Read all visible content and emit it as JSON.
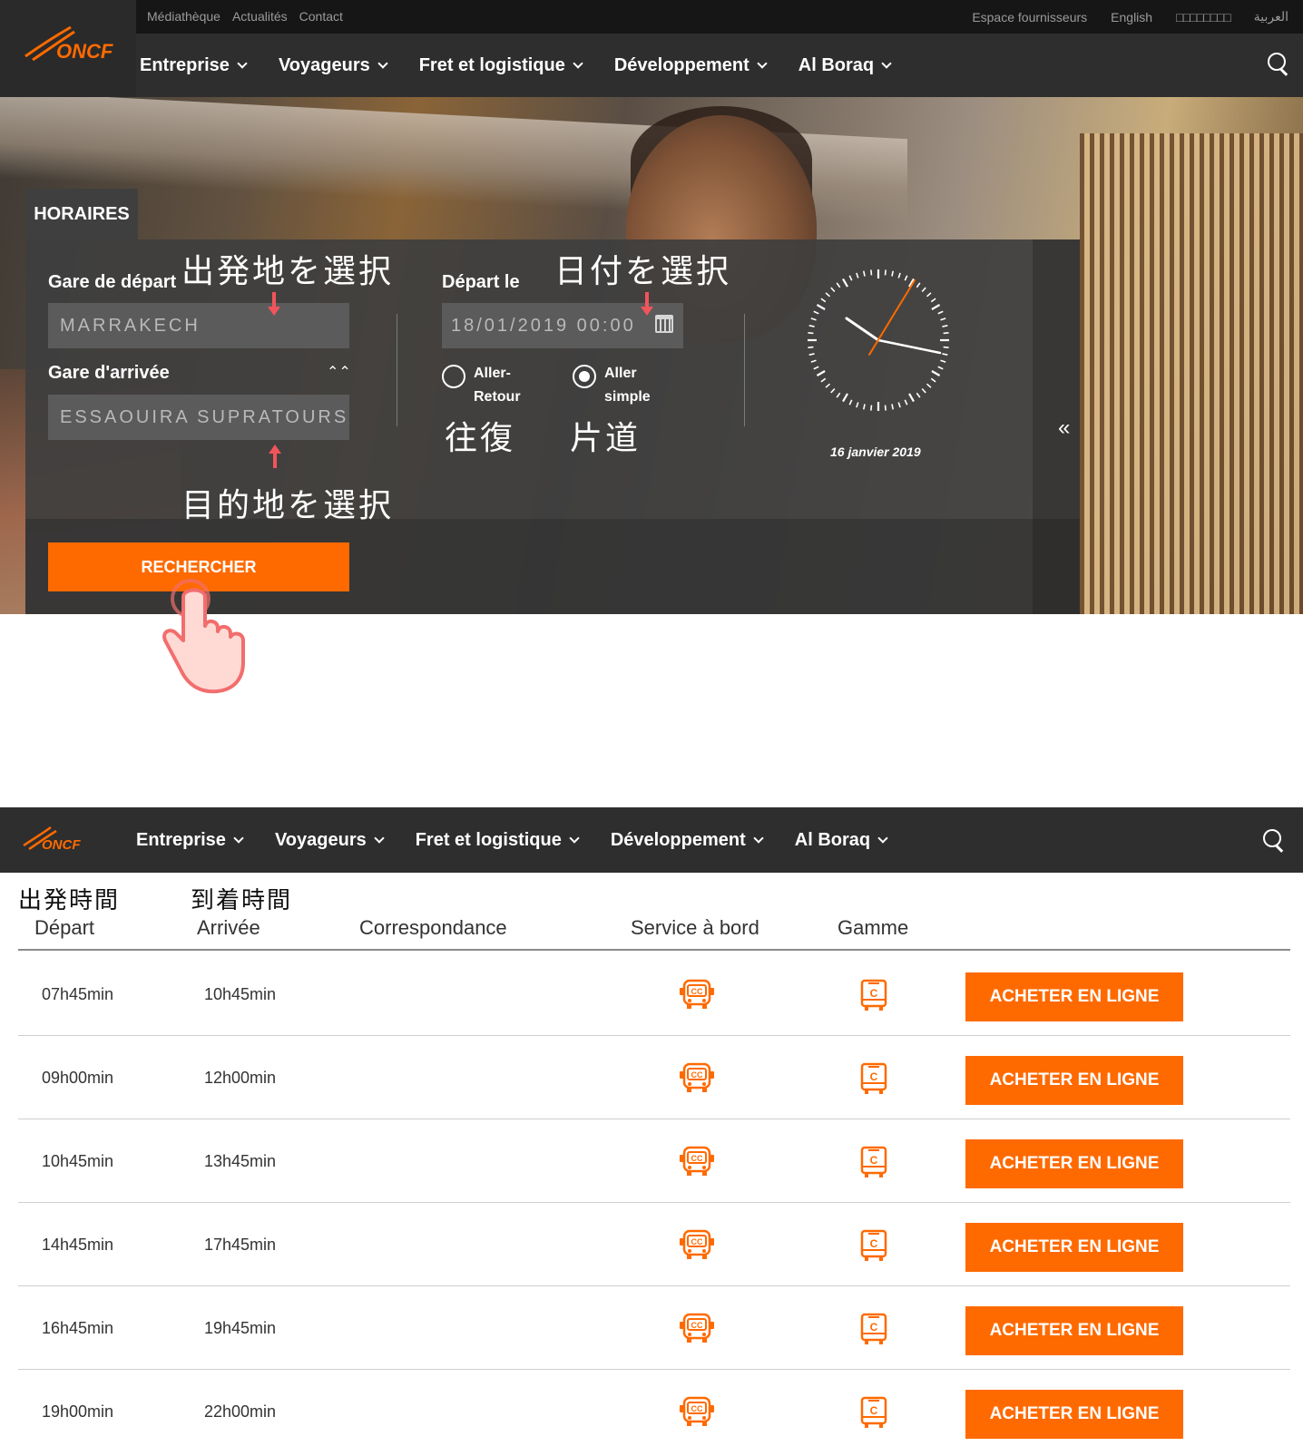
{
  "brand": {
    "logo_text": "ONCF"
  },
  "utility_links": [
    "Médiathèque",
    "Actualités",
    "Contact"
  ],
  "utility_right": {
    "suppliers": "Espace fournisseurs",
    "lang_en": "English",
    "lang_cjk": "□□□□□□□□",
    "lang_ar": "العربية"
  },
  "nav": {
    "items": [
      "Entreprise",
      "Voyageurs",
      "Fret et logistique",
      "Développement",
      "Al Boraq"
    ]
  },
  "search_form": {
    "tab_label": "HORAIRES",
    "departure_label": "Gare de départ",
    "departure_value": "MARRAKECH",
    "arrival_label": "Gare d'arrivée",
    "arrival_value": "ESSAOUIRA  SUPRATOURS",
    "date_label": "Départ le",
    "date_value": "18/01/2019 00:00",
    "trip_round_label": "Aller-\nRetour",
    "trip_oneway_label": "Aller\nsimple",
    "trip_selected": "Aller simple",
    "search_button": "RECHERCHER",
    "clock_date": "16 janvier 2019"
  },
  "annotations": {
    "select_departure": "出発地を選択",
    "select_date": "日付を選択",
    "round_trip": "往復",
    "one_way": "片道",
    "select_destination": "目的地を選択",
    "departure_time": "出発時間",
    "arrival_time": "到着時間"
  },
  "results": {
    "headers": [
      "Départ",
      "Arrivée",
      "Correspondance",
      "Service à bord",
      "Gamme"
    ],
    "buy_label": "ACHETER EN LIGNE",
    "service_icon": "bus-cc-icon",
    "range_icon": "coach-c-icon",
    "rows": [
      {
        "departure": "07h45min",
        "arrival": "10h45min"
      },
      {
        "departure": "09h00min",
        "arrival": "12h00min"
      },
      {
        "departure": "10h45min",
        "arrival": "13h45min"
      },
      {
        "departure": "14h45min",
        "arrival": "17h45min"
      },
      {
        "departure": "16h45min",
        "arrival": "19h45min"
      },
      {
        "departure": "19h00min",
        "arrival": "22h00min"
      }
    ]
  },
  "colors": {
    "accent": "#ff6a00",
    "annotation_arrow": "#f2545b",
    "dark_nav": "#2e2e2e"
  }
}
